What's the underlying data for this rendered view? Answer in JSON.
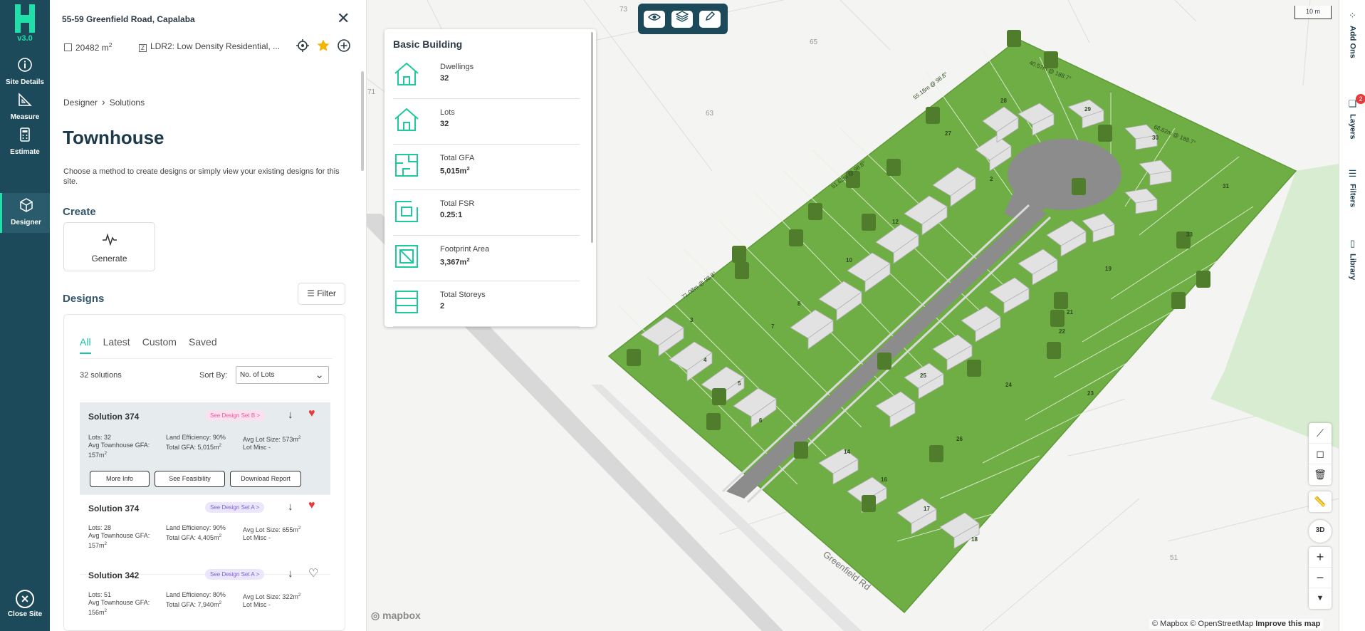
{
  "app": {
    "version": "v3.0"
  },
  "rail": {
    "items": [
      {
        "label": "Site Details",
        "icon": "info-icon"
      },
      {
        "label": "Measure",
        "icon": "measure-icon"
      },
      {
        "label": "Estimate",
        "icon": "calculator-icon"
      },
      {
        "label": "Designer",
        "icon": "designer-cube-icon"
      }
    ],
    "close_label": "Close Site"
  },
  "site": {
    "address": "55-59 Greenfield Road, Capalaba",
    "area_value": "20482 m",
    "area_sup": "2",
    "zone_code": "Z",
    "zoning": "LDR2: Low Density Residential, ..."
  },
  "breadcrumb": {
    "root": "Designer",
    "current": "Solutions"
  },
  "page": {
    "title": "Townhouse",
    "description": "Choose a method to create designs or simply view your existing designs for this site.",
    "create_heading": "Create",
    "generate_label": "Generate",
    "designs_heading": "Designs",
    "filter_label": "Filter"
  },
  "designs": {
    "tabs": [
      "All",
      "Latest",
      "Custom",
      "Saved"
    ],
    "active_tab": "All",
    "count_text": "32 solutions",
    "sort_label": "Sort By:",
    "sort_value": "No. of Lots",
    "solutions": [
      {
        "name": "Solution 374",
        "badge": "See Design Set B  >",
        "favorited": true,
        "lots": "Lots: 32",
        "avg_gfa_label": "Avg Townhouse GFA:",
        "avg_gfa": "157m",
        "avg_gfa_sup": "2",
        "land_eff": "Land Efficiency: 90%",
        "total_gfa": "Total GFA: 5,015m",
        "total_gfa_sup": "2",
        "avg_lot": "Avg Lot Size: 573m",
        "avg_lot_sup": "2",
        "lot_misc": "Lot Misc -",
        "buttons": [
          "More Info",
          "See Feasibility",
          "Download Report"
        ]
      },
      {
        "name": "Solution 374",
        "badge": "See Design Set A  >",
        "favorited": true,
        "lots": "Lots: 28",
        "avg_gfa_label": "Avg Townhouse GFA:",
        "avg_gfa": "157m",
        "avg_gfa_sup": "2",
        "land_eff": "Land Efficiency: 90%",
        "total_gfa": "Total GFA: 4,405m",
        "total_gfa_sup": "2",
        "avg_lot": "Avg Lot Size: 655m",
        "avg_lot_sup": "2",
        "lot_misc": "Lot Misc -"
      },
      {
        "name": "Solution 342",
        "badge": "See Design Set A  >",
        "favorited": false,
        "lots": "Lots: 51",
        "avg_gfa_label": "Avg Townhouse GFA:",
        "avg_gfa": "156m",
        "avg_gfa_sup": "2",
        "land_eff": "Land Efficiency: 80%",
        "total_gfa": "Total GFA: 7,940m",
        "total_gfa_sup": "2",
        "avg_lot": "Avg Lot Size: 322m",
        "avg_lot_sup": "2",
        "lot_misc": "Lot Misc -"
      }
    ]
  },
  "info_card": {
    "title": "Basic Building",
    "rows": [
      {
        "label": "Dwellings",
        "value": "32",
        "sup": "",
        "icon": "house-icon"
      },
      {
        "label": "Lots",
        "value": "32",
        "sup": "",
        "icon": "house-icon"
      },
      {
        "label": "Total GFA",
        "value": "5,015m",
        "sup": "2",
        "icon": "floorplan-icon"
      },
      {
        "label": "Total FSR",
        "value": "0.25:1",
        "sup": "",
        "icon": "fsr-icon"
      },
      {
        "label": "Footprint Area",
        "value": "3,367m",
        "sup": "2",
        "icon": "footprint-icon"
      },
      {
        "label": "Total Storeys",
        "value": "2",
        "sup": "",
        "icon": "storeys-icon"
      }
    ]
  },
  "map": {
    "toolbar": [
      "eye-icon",
      "layers-icon",
      "pencil-icon"
    ],
    "scale": "10 m",
    "road_label": "Greenfield Rd",
    "parcel_labels": [
      "73",
      "65",
      "71",
      "63",
      "51"
    ],
    "dimension_labels": [
      "40.57m @ 188.7°",
      "55.18m @ 98.8°",
      "68.62m @ 188.7°",
      "51.62m @ 98.8°",
      "71.08m @ 98.8°"
    ],
    "lot_numbers": [
      "28",
      "27",
      "29",
      "30",
      "31",
      "12",
      "10",
      "8",
      "7",
      "3",
      "4",
      "5",
      "6",
      "19",
      "21",
      "22",
      "24",
      "23",
      "25",
      "26",
      "14",
      "16",
      "17",
      "18",
      "2",
      "33"
    ],
    "colors": {
      "grass": "#6fae45",
      "road": "#8c8c8c",
      "building": "#e0e0e0",
      "tree": "#4f7d2c"
    },
    "attribution": "© Mapbox © OpenStreetMap",
    "improve": "Improve this map",
    "mapbox_logo": "mapbox",
    "controls": [
      "line-icon",
      "polygon-icon",
      "trash-icon",
      "ruler-icon",
      "3d-icon",
      "zoom-in-icon",
      "zoom-out-icon",
      "compass-icon"
    ],
    "control_labels": {
      "three_d": "3D"
    }
  },
  "right_rail": [
    {
      "label": "Add Ons",
      "icon": "addons-icon",
      "badge": ""
    },
    {
      "label": "Layers",
      "icon": "layers-icon",
      "badge": "2"
    },
    {
      "label": "Filters",
      "icon": "filters-icon",
      "badge": ""
    },
    {
      "label": "Library",
      "icon": "library-icon",
      "badge": ""
    }
  ]
}
